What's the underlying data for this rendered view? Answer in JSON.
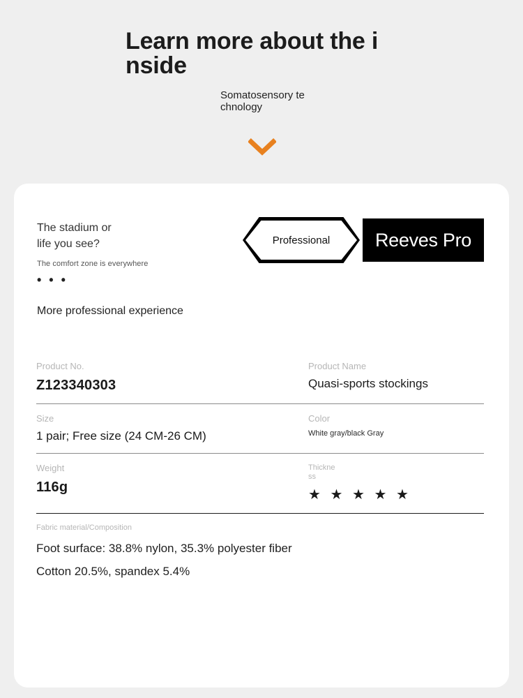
{
  "hero": {
    "title": "Learn more about the inside",
    "subtitle": "Somatosensory technology",
    "chevron_icon": "chevron-down-icon",
    "chevron_color": "#e8811f",
    "background_color": "#efefef"
  },
  "card": {
    "background_color": "#ffffff",
    "brand": {
      "tagline": "The stadium or\nlife you see?",
      "subtag": "The comfort zone is everywhere",
      "dots": "• • •",
      "experience": "More professional experience",
      "badge_label": "Professional",
      "brand_name": "Reeves Pro",
      "brand_bg": "#000000",
      "brand_fg": "#ffffff"
    },
    "specs": [
      {
        "left": {
          "label": "Product No.",
          "value": "Z123340303"
        },
        "right": {
          "label": "Product Name",
          "value": "Quasi-sports stockings"
        }
      },
      {
        "left": {
          "label": "Size",
          "value": "1 pair; Free size (24 CM-26 CM)"
        },
        "right": {
          "label": "Color",
          "value": "White gray/black Gray"
        }
      },
      {
        "left": {
          "label": "Weight",
          "value": "116g"
        },
        "right": {
          "label": "Thickness",
          "value": "★ ★ ★ ★ ★",
          "rating": 5
        }
      }
    ],
    "fabric": {
      "label": "Fabric material/Composition",
      "line1": "Foot surface: 38.8% nylon, 35.3% polyester fiber",
      "line2": "Cotton 20.5%, spandex 5.4%"
    }
  }
}
